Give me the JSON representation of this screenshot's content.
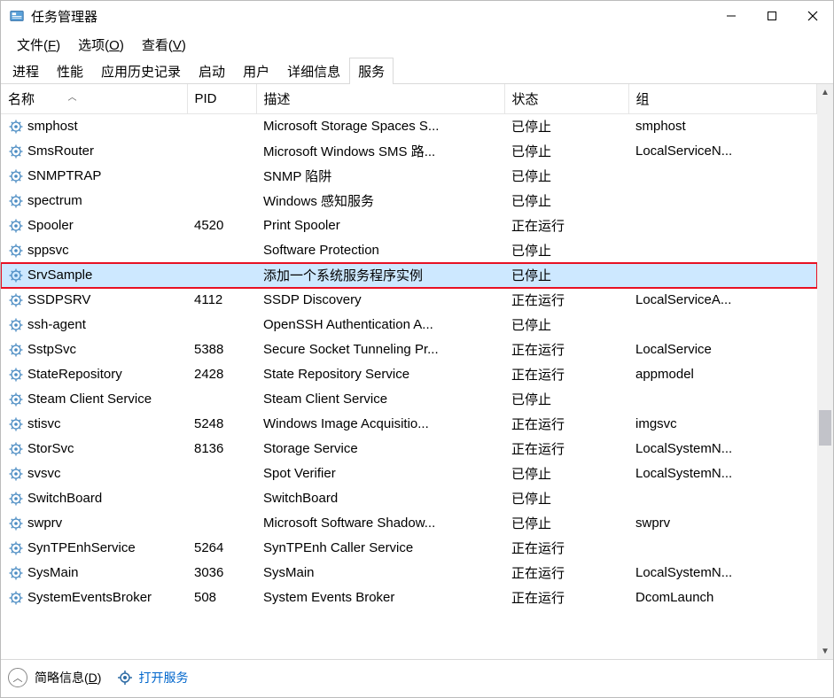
{
  "title": "任务管理器",
  "menu": {
    "file": "文件(",
    "file_u": "F",
    "file_end": ")",
    "options": "选项(",
    "options_u": "O",
    "options_end": ")",
    "view": "查看(",
    "view_u": "V",
    "view_end": ")"
  },
  "tabs": {
    "processes": "进程",
    "performance": "性能",
    "history": "应用历史记录",
    "startup": "启动",
    "users": "用户",
    "details": "详细信息",
    "services": "服务"
  },
  "columns": {
    "name": "名称",
    "pid": "PID",
    "desc": "描述",
    "status": "状态",
    "group": "组"
  },
  "rows": [
    {
      "name": "smphost",
      "pid": "",
      "desc": "Microsoft Storage Spaces S...",
      "status": "已停止",
      "group": "smphost"
    },
    {
      "name": "SmsRouter",
      "pid": "",
      "desc": "Microsoft Windows SMS 路...",
      "status": "已停止",
      "group": "LocalServiceN..."
    },
    {
      "name": "SNMPTRAP",
      "pid": "",
      "desc": "SNMP 陷阱",
      "status": "已停止",
      "group": ""
    },
    {
      "name": "spectrum",
      "pid": "",
      "desc": "Windows 感知服务",
      "status": "已停止",
      "group": ""
    },
    {
      "name": "Spooler",
      "pid": "4520",
      "desc": "Print Spooler",
      "status": "正在运行",
      "group": ""
    },
    {
      "name": "sppsvc",
      "pid": "",
      "desc": "Software Protection",
      "status": "已停止",
      "group": ""
    },
    {
      "name": "SrvSample",
      "pid": "",
      "desc": "添加一个系统服务程序实例",
      "status": "已停止",
      "group": ""
    },
    {
      "name": "SSDPSRV",
      "pid": "4112",
      "desc": "SSDP Discovery",
      "status": "正在运行",
      "group": "LocalServiceA..."
    },
    {
      "name": "ssh-agent",
      "pid": "",
      "desc": "OpenSSH Authentication A...",
      "status": "已停止",
      "group": ""
    },
    {
      "name": "SstpSvc",
      "pid": "5388",
      "desc": "Secure Socket Tunneling Pr...",
      "status": "正在运行",
      "group": "LocalService"
    },
    {
      "name": "StateRepository",
      "pid": "2428",
      "desc": "State Repository Service",
      "status": "正在运行",
      "group": "appmodel"
    },
    {
      "name": "Steam Client Service",
      "pid": "",
      "desc": "Steam Client Service",
      "status": "已停止",
      "group": ""
    },
    {
      "name": "stisvc",
      "pid": "5248",
      "desc": "Windows Image Acquisitio...",
      "status": "正在运行",
      "group": "imgsvc"
    },
    {
      "name": "StorSvc",
      "pid": "8136",
      "desc": "Storage Service",
      "status": "正在运行",
      "group": "LocalSystemN..."
    },
    {
      "name": "svsvc",
      "pid": "",
      "desc": "Spot Verifier",
      "status": "已停止",
      "group": "LocalSystemN..."
    },
    {
      "name": "SwitchBoard",
      "pid": "",
      "desc": "SwitchBoard",
      "status": "已停止",
      "group": ""
    },
    {
      "name": "swprv",
      "pid": "",
      "desc": "Microsoft Software Shadow...",
      "status": "已停止",
      "group": "swprv"
    },
    {
      "name": "SynTPEnhService",
      "pid": "5264",
      "desc": "SynTPEnh Caller Service",
      "status": "正在运行",
      "group": ""
    },
    {
      "name": "SysMain",
      "pid": "3036",
      "desc": "SysMain",
      "status": "正在运行",
      "group": "LocalSystemN..."
    },
    {
      "name": "SystemEventsBroker",
      "pid": "508",
      "desc": "System Events Broker",
      "status": "正在运行",
      "group": "DcomLaunch"
    }
  ],
  "selected_index": 6,
  "bottom": {
    "brief": "简略信息(",
    "brief_u": "D",
    "brief_end": ")",
    "open_services": "打开服务"
  }
}
